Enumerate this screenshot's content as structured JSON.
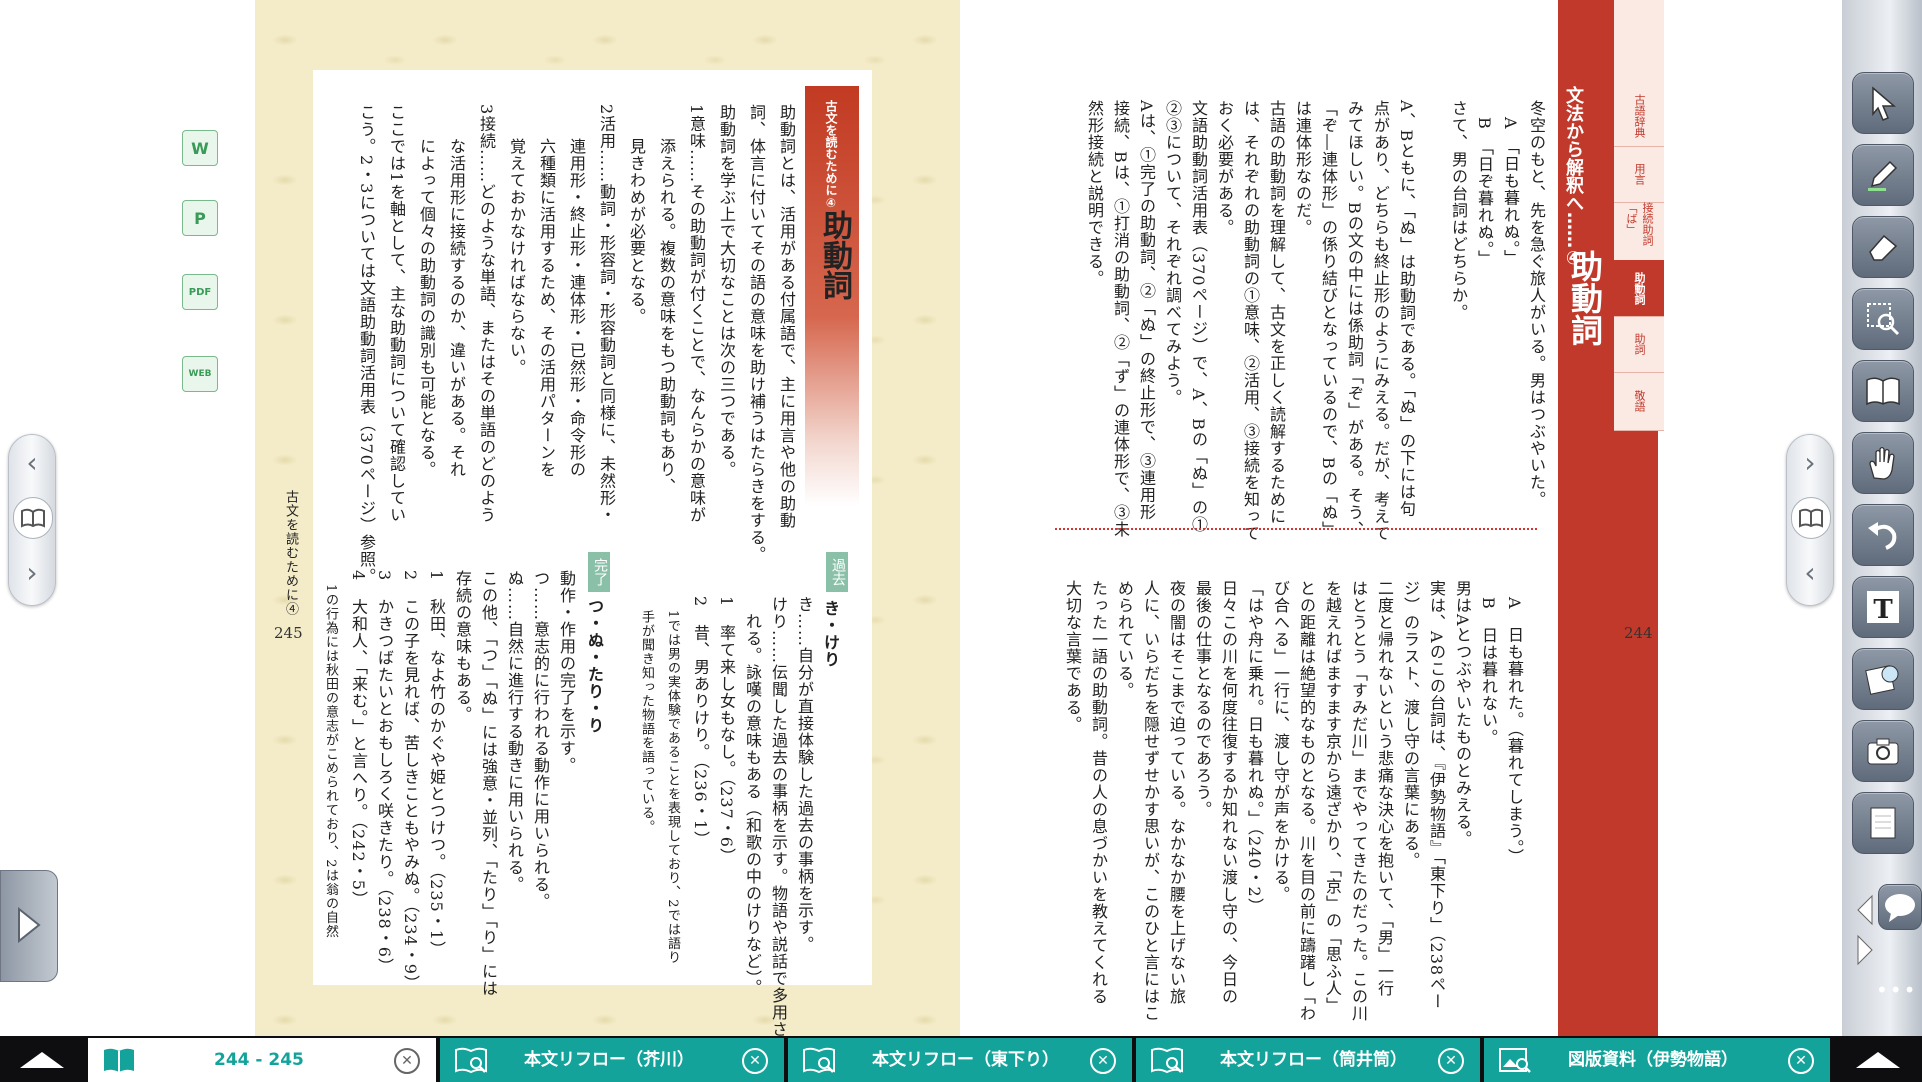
{
  "file_icons": [
    "W",
    "P",
    "PDF",
    "WEB"
  ],
  "left_page": {
    "section_label": "古文を読むために④",
    "section_title": "助動詞",
    "running_head": "古文を読むために④",
    "page_number": "245",
    "body": [
      "助動詞とは、活用がある付属語で、主に用言や他の助動",
      "詞、体言に付いてその語の意味を助け補うはたらきをする。",
      "助動詞を学ぶ上で大切なことは次の三つである。",
      "1意味……その助動詞が付くことで、なんらかの意味が",
      "　　添えられる。複数の意味をもつ助動詞もあり、",
      "　　見きわめが必要となる。",
      "2活用……動詞・形容詞・形容動詞と同様に、未然形・",
      "　　連用形・終止形・連体形・已然形・命令形の",
      "　　六種類に活用するため、その活用パターンを",
      "　　覚えておかなければならない。",
      "3接続……どのような単語、またはその単語のどのよう",
      "　　な活用形に接続するのか、違いがある。それ",
      "　　によって個々の助動詞の識別も可能となる。",
      "ここでは1を軸として、主な助動詞について確認してい",
      "こう。2・3については文語助動詞活用表（370ページ）参照。"
    ],
    "past_tag": "過去",
    "past_heading": "き・けり",
    "past_lines": [
      "き……自分が直接体験した過去の事柄を示す。",
      "けり……伝聞した過去の事柄を示す。物語や説話で多用さ",
      "　れる。詠嘆の意味もある（和歌の中のけりなど）。",
      "1　率て来し女もなし。（237・6）",
      "2　昔、男ありけり。（236・1）",
      "　1では男の実体験であることを表現しており、2では語り",
      "　手が聞き知った物語を語っている。"
    ],
    "perfect_tag": "完了",
    "perfect_heading": "つ・ぬ・たり・り",
    "perfect_lines": [
      "動作・作用の完了を示す。",
      "つ……意志的に行われる動作に用いられる。",
      "ぬ……自然に進行する動きに用いられる。",
      "この他、「つ」「ぬ」には強意・並列、「たり」「り」には",
      "存続の意味もある。",
      "1　秋田、なよ竹のかぐや姫とつけつ。（235・1）",
      "2　この子を見れば、苦しきこともやみぬ。（234・9）",
      "3　かきつばたいとおもしろく咲きたり。（238・6）",
      "4　大和人、「来む。」と言へり。（242・5）",
      "　1の行為には秋田の意志がこめられており、2は翁の自然"
    ]
  },
  "right_page": {
    "banner_text": "文法から解釈へ……④",
    "banner_title": "助動詞",
    "page_number": "244",
    "side_tabs": [
      "古語辞典",
      "用言",
      "接続助詞「ば」",
      "助動詞",
      "助詞",
      "敬語"
    ],
    "active_side_tab": "助動詞",
    "upper_lines": [
      "冬空のもと、先を急ぐ旅人がいる。男はつぶやいた。",
      "　A　「日も暮れぬ。」",
      "　B　「日ぞ暮れぬ。」",
      "さて、男の台詞はどちらか。",
      "",
      "A、Bともに、「ぬ」は助動詞である。「ぬ」の下には句",
      "点があり、どちらも終止形のようにみえる。だが、考えて",
      "みてほしい。Bの文の中には係助詞「ぞ」がある。そう、",
      "「ぞ―連体形」の係り結びとなっているので、Bの「ぬ」",
      "は連体形なのだ。",
      "古語の助動詞を理解して、古文を正しく読解するために",
      "は、それぞれの助動詞の①意味、②活用、③接続を知って",
      "おく必要がある。",
      "文語助動詞活用表（370ページ）で、A、Bの「ぬ」の①",
      "②③について、それぞれ調べてみよう。",
      "Aは、①完了の助動詞、②「ぬ」の終止形で、③連用形",
      "接続、Bは、①打消の助動詞、②「ず」の連体形で、③未",
      "然形接続と説明できる。"
    ],
    "lower_lines": [
      "　A　日も暮れた。（暮れてしまう。）",
      "　B　日は暮れない。",
      "男はAとつぶやいたものとみえる。",
      "実は、Aのこの台詞は、『伊勢物語』「東下り」（238ペー",
      "ジ）のラスト、渡し守の言葉にある。",
      "二度と帰れないという悲痛な決心を抱いて、「男」一行",
      "はとうとう「すみだ川」までやってきたのだった。この川",
      "を越えればますます京から遠ざかり、「京」の「思ふ人」",
      "との距離は絶望的なものとなる。川を目の前に躊躇し「わ",
      "び合へる」一行に、渡し守が声をかける。",
      "「はや舟に乗れ。日も暮れぬ。」（240・2）",
      "日々この川を何度往復するか知れない渡し守の、今日の",
      "最後の仕事となるのであろう。",
      "夜の闇はそこまで迫っている。なかなか腰を上げない旅",
      "人に、いらだちを隠せずせかす思いが、このひと言にはこ",
      "められている。",
      "たった一語の助動詞。昔の人の息づかいを教えてくれる",
      "大切な言葉である。"
    ]
  },
  "tabs": [
    {
      "label": "244 - 245",
      "icon": "book-icon"
    },
    {
      "label": "本文リフロー（芥川）",
      "icon": "book-search-icon"
    },
    {
      "label": "本文リフロー（東下り）",
      "icon": "book-search-icon"
    },
    {
      "label": "本文リフロー（筒井筒）",
      "icon": "book-search-icon"
    },
    {
      "label": "図版資料（伊勢物語）",
      "icon": "image-search-icon"
    }
  ],
  "tools": [
    "pointer-icon",
    "pen-icon",
    "eraser-icon",
    "zoom-region-icon",
    "book-icon",
    "hand-icon",
    "undo-icon",
    "text-icon",
    "stamp-icon",
    "camera-icon",
    "notebook-icon"
  ],
  "colors": {
    "accent_red": "#c0392b",
    "teal": "#13a39a",
    "section_green": "#8ac0a8"
  }
}
